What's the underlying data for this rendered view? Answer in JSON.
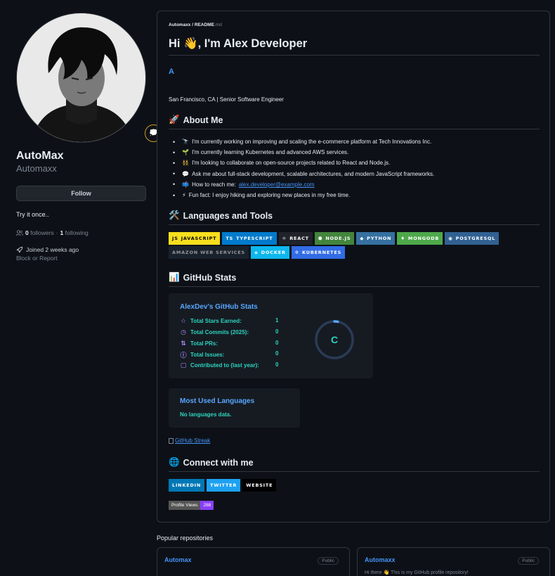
{
  "profile": {
    "display_name": "AutoMax",
    "username": "Automaxx",
    "follow_label": "Follow",
    "status_emoji": "💭",
    "bio": "Try it once..",
    "followers_count": "0",
    "followers_label": "followers",
    "separator": "·",
    "following_count": "1",
    "following_label": "following",
    "joined": "Joined 2 weeks ago",
    "block_label": "Block or Report"
  },
  "readme": {
    "crumb_user": "Automaxx",
    "crumb_sep": " / ",
    "crumb_file": "README",
    "crumb_ext": ".md",
    "title": "Hi 👋, I'm Alex Developer",
    "initial": "A",
    "location": "San Francisco, CA | Senior Software Engineer",
    "about_heading": "About Me",
    "about_icon": "🚀",
    "about_items": [
      {
        "icon": "🔭",
        "text": "I'm currently working on improving and scaling the e-commerce platform at Tech Innovations Inc."
      },
      {
        "icon": "🌱",
        "text": "I'm currently learning Kubernetes and advanced AWS services."
      },
      {
        "icon": "👯",
        "text": "I'm looking to collaborate on open-source projects related to React and Node.js."
      },
      {
        "icon": "💬",
        "text": "Ask me about full-stack development, scalable architectures, and modern JavaScript frameworks."
      },
      {
        "icon": "📫",
        "text": "How to reach me: ",
        "link": "alex.developer@example.com"
      },
      {
        "icon": "⚡",
        "text": "Fun fact: I enjoy hiking and exploring new places in my free time."
      }
    ],
    "tools_heading": "Languages and Tools",
    "tools_icon": "🛠️",
    "tools_row1": [
      {
        "label": "JAVASCRIPT",
        "icon": "JS",
        "bg": "#f7df1e",
        "fg": "#000000"
      },
      {
        "label": "TYPESCRIPT",
        "icon": "TS",
        "bg": "#007acc",
        "fg": "#ffffff"
      },
      {
        "label": "REACT",
        "icon": "⚛",
        "bg": "#20232a",
        "fg": "#ffffff"
      },
      {
        "label": "NODE.JS",
        "icon": "⬢",
        "bg": "#43853d",
        "fg": "#ffffff"
      },
      {
        "label": "PYTHON",
        "icon": "◆",
        "bg": "#3670a0",
        "fg": "#ffffff"
      },
      {
        "label": "MONGODB",
        "icon": "♦",
        "bg": "#4ea94b",
        "fg": "#ffffff"
      },
      {
        "label": "POSTGRESQL",
        "icon": "◉",
        "bg": "#316192",
        "fg": "#ffffff"
      }
    ],
    "tools_row2": [
      {
        "label": "AMAZON WEB SERVICES",
        "icon": "",
        "bg": "#232f3e",
        "fg": "#ffffff"
      },
      {
        "label": "DOCKER",
        "icon": "◈",
        "bg": "#0db7ed",
        "fg": "#ffffff"
      },
      {
        "label": "KUBERNETES",
        "icon": "✲",
        "bg": "#326ce5",
        "fg": "#ffffff"
      }
    ],
    "stats_heading": "GitHub Stats",
    "stats_icon": "📊",
    "stats_card": {
      "title": "AlexDev's GitHub Stats",
      "rows": [
        {
          "icon": "☆",
          "label": "Total Stars Earned:",
          "value": "1"
        },
        {
          "icon": "◷",
          "label": "Total Commits (2025):",
          "value": "0"
        },
        {
          "icon": "⇅",
          "label": "Total PRs:",
          "value": "0"
        },
        {
          "icon": "ⓘ",
          "label": "Total Issues:",
          "value": "0"
        },
        {
          "icon": "▢",
          "label": "Contributed to (last year):",
          "value": "0"
        }
      ],
      "rank": "C",
      "rank_progress": 0.03
    },
    "langs_card": {
      "title": "Most Used Languages",
      "empty": "No languages data."
    },
    "streak_alt": "GitHub Streak",
    "connect_heading": "Connect with me",
    "connect_icon": "🌐",
    "connect_badges": [
      {
        "label": "LINKEDIN",
        "bg": "#0077b5",
        "fg": "#ffffff"
      },
      {
        "label": "TWITTER",
        "bg": "#1da1f2",
        "fg": "#ffffff"
      },
      {
        "label": "WEBSITE",
        "bg": "#000000",
        "fg": "#ffffff"
      }
    ],
    "views_label": "Profile Views",
    "views_count": "288"
  },
  "popular": {
    "heading": "Popular repositories",
    "repos": [
      {
        "name": "Automax",
        "visibility": "Public",
        "description": ""
      },
      {
        "name": "Automaxx",
        "visibility": "Public",
        "description": "Hi there 👋 This is my GitHub profile repository!"
      }
    ]
  }
}
